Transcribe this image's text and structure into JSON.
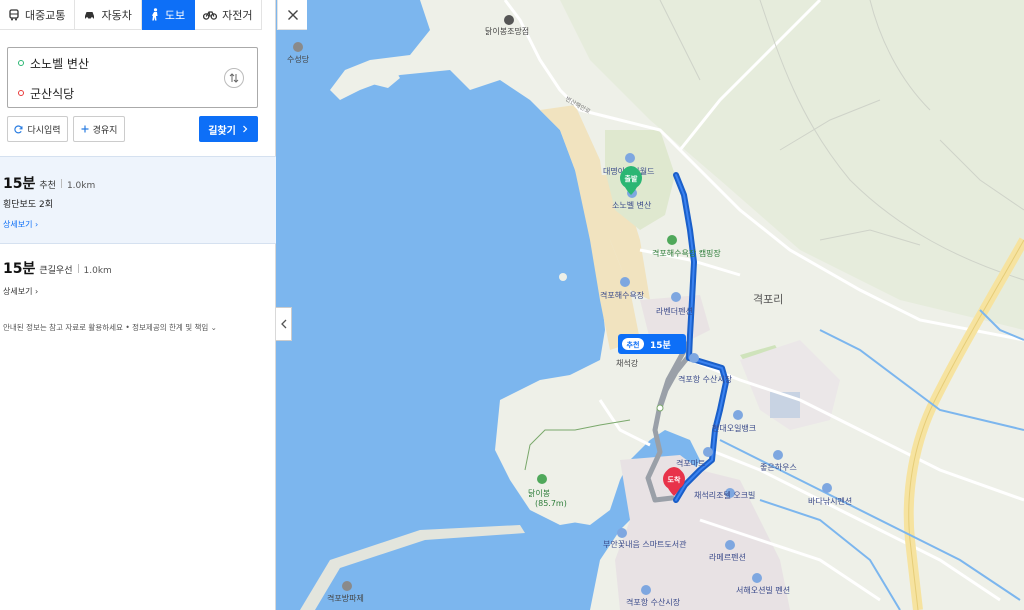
{
  "modes": [
    {
      "label": "대중교통",
      "icon": "bus-icon"
    },
    {
      "label": "자동차",
      "icon": "car-icon"
    },
    {
      "label": "도보",
      "icon": "walk-icon",
      "active": true
    },
    {
      "label": "자전거",
      "icon": "bicycle-icon"
    }
  ],
  "route": {
    "from": "소노벨 변산",
    "to": "군산식당"
  },
  "buttons": {
    "reset": "다시입력",
    "waypoint": "경유지",
    "search": "길찾기"
  },
  "results": [
    {
      "time": "15분",
      "tag": "추천",
      "distance": "1.0km",
      "detail": "횡단보도 2회",
      "more": "상세보기"
    },
    {
      "time": "15분",
      "tag": "큰길우선",
      "distance": "1.0km",
      "more": "상세보기"
    }
  ],
  "notice": "안내된 정보는 참고 자료로 활용하세요 • 정보제공의 한계 및 책임",
  "map": {
    "route_badge": {
      "tag": "추천",
      "time": "15분"
    },
    "start_marker": "출발",
    "end_marker": "도착",
    "labels": {
      "store": "닭이봉조망점",
      "suseongdang": "수성당",
      "daemyung": "대명아쿠아월드",
      "sonobel": "소노벨 변산",
      "camping": "격포해수욕장 캠핑장",
      "beach": "격포해수욕장",
      "lavender": "라벤더펜션",
      "chaeseokgang": "채석강",
      "market": "격포항 수산시장",
      "oilbank": "현대오일뱅크",
      "gyeokpo_main": "격포리",
      "goodhouse": "좋은하우스",
      "fishing": "바다낚시펜션",
      "gyeokpo_store": "격포마트",
      "chaeseokri": "채석리조텔 오크빌",
      "lamer": "라메르펜션",
      "library": "부안꽃내음 스마트도서관",
      "seohae": "서해오션빌 펜션",
      "port_market": "격포항 수산시장",
      "dalibong": "닭이봉",
      "dalibong_height": "(85.7m)",
      "breakwater": "격포방파제",
      "roadname": "변산해안로"
    }
  },
  "colors": {
    "accent": "#0d6ff7",
    "route_blue": "#1a5fc9",
    "route_gray": "#9aa0a8",
    "start_green": "#2bb673",
    "end_red": "#e8334a",
    "sea": "#7cb6ee",
    "land": "#eef0e8",
    "sand": "#f1e3bf"
  }
}
